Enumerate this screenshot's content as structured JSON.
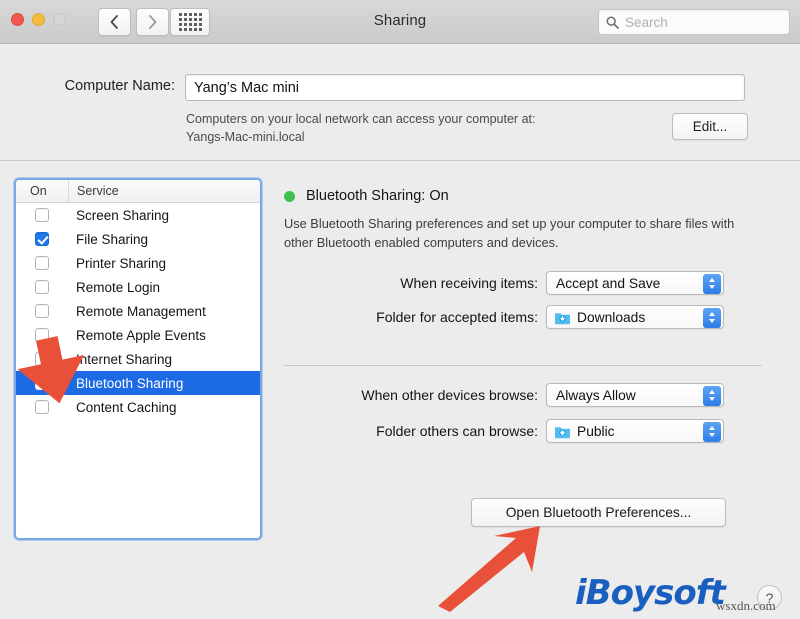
{
  "window": {
    "title": "Sharing",
    "traffic_lights": [
      "close",
      "minimize",
      "zoom"
    ],
    "back_label": "‹",
    "forward_label": "›",
    "grid_label": "show-all"
  },
  "search": {
    "placeholder": "Search",
    "value": ""
  },
  "computer_name": {
    "label": "Computer Name:",
    "value": "Yang’s Mac mini",
    "help_line1": "Computers on your local network can access your computer at:",
    "help_line2": "Yangs-Mac-mini.local",
    "edit_label": "Edit..."
  },
  "service_list": {
    "columns": {
      "on": "On",
      "service": "Service"
    },
    "rows": [
      {
        "label": "Screen Sharing",
        "checked": false,
        "selected": false
      },
      {
        "label": "File Sharing",
        "checked": true,
        "selected": false
      },
      {
        "label": "Printer Sharing",
        "checked": false,
        "selected": false
      },
      {
        "label": "Remote Login",
        "checked": false,
        "selected": false
      },
      {
        "label": "Remote Management",
        "checked": false,
        "selected": false
      },
      {
        "label": "Remote Apple Events",
        "checked": false,
        "selected": false
      },
      {
        "label": "Internet Sharing",
        "checked": false,
        "selected": false
      },
      {
        "label": "Bluetooth Sharing",
        "checked": true,
        "selected": true
      },
      {
        "label": "Content Caching",
        "checked": false,
        "selected": false
      }
    ]
  },
  "detail": {
    "status_text": "Bluetooth Sharing: On",
    "status_color": "#3fc24a",
    "description": "Use Bluetooth Sharing preferences and set up your computer to share files with other Bluetooth enabled computers and devices.",
    "fields": [
      {
        "label": "When receiving items:",
        "value": "Accept and Save",
        "icon": "none"
      },
      {
        "label": "Folder for accepted items:",
        "value": "Downloads",
        "icon": "folder-download-icon"
      },
      {
        "label": "When other devices browse:",
        "value": "Always Allow",
        "icon": "none"
      },
      {
        "label": "Folder others can browse:",
        "value": "Public",
        "icon": "folder-public-icon"
      }
    ],
    "open_button": "Open Bluetooth Preferences..."
  },
  "annotations": {
    "arrow_color": "#e8503a",
    "arrow_list_target": "Bluetooth Sharing row",
    "arrow_button_target": "Open Bluetooth Preferences button"
  },
  "watermark": {
    "logo_i": "i",
    "logo_rest": "Boysoft",
    "site": "wsxdn.com",
    "help_label": "?"
  },
  "colors": {
    "selection_blue": "#1d6ae5",
    "checkbox_blue": "#2079e8",
    "focus_ring": "#7aa7e8",
    "window_bg": "#ececec",
    "logo_blue": "#1a5fc0"
  }
}
